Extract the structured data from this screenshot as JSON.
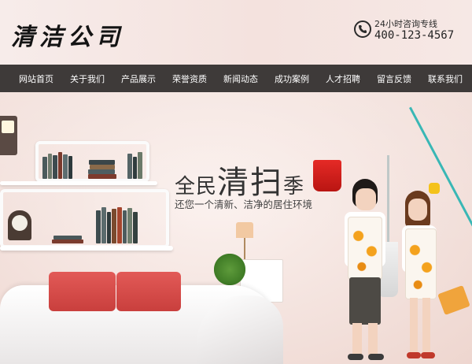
{
  "header": {
    "logo_text": "清洁公司",
    "hotline_label": "24小时咨询专线",
    "hotline_number": "400-123-4567",
    "phone_icon": "phone-icon"
  },
  "nav": {
    "items": [
      {
        "label": "网站首页"
      },
      {
        "label": "关于我们"
      },
      {
        "label": "产品展示"
      },
      {
        "label": "荣誉资质"
      },
      {
        "label": "新闻动态"
      },
      {
        "label": "成功案例"
      },
      {
        "label": "人才招聘"
      },
      {
        "label": "留言反馈"
      },
      {
        "label": "联系我们"
      }
    ]
  },
  "banner": {
    "slogan_part1": "全民",
    "slogan_part2": "清扫",
    "slogan_part3": "季",
    "subtitle": "还您一个清新、洁净的居住环境"
  },
  "colors": {
    "nav_background": "#3e3a39",
    "banner_background": "#f3e1dc",
    "cushion": "#d84a47",
    "bucket": "#e52a26",
    "broom": "#39b7b5"
  }
}
